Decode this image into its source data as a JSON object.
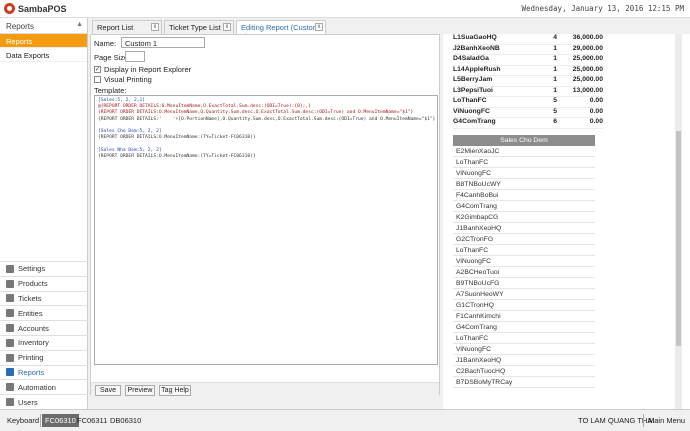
{
  "app": {
    "name": "SambaPOS",
    "datetime": "Wednesday, January 13, 2016 12:15 PM"
  },
  "sidebar": {
    "header": "Reports",
    "subitems": [
      {
        "label": "Reports"
      },
      {
        "label": "Data Exports"
      }
    ],
    "nav": [
      {
        "label": "Settings",
        "icon": "gear-icon"
      },
      {
        "label": "Products",
        "icon": "box-icon"
      },
      {
        "label": "Tickets",
        "icon": "ticket-icon"
      },
      {
        "label": "Entities",
        "icon": "entity-icon"
      },
      {
        "label": "Accounts",
        "icon": "account-icon"
      },
      {
        "label": "Inventory",
        "icon": "inventory-icon"
      },
      {
        "label": "Printing",
        "icon": "printer-icon"
      },
      {
        "label": "Reports",
        "icon": "chart-icon"
      },
      {
        "label": "Automation",
        "icon": "automation-icon"
      },
      {
        "label": "Users",
        "icon": "user-icon"
      }
    ]
  },
  "tabs": [
    {
      "label": "Report List"
    },
    {
      "label": "Ticket Type List"
    },
    {
      "label": "Editing Report (Custom 1)"
    }
  ],
  "editor": {
    "name_label": "Name:",
    "name_value": "Custom 1",
    "page_size_label": "Page Size:",
    "page_size_value": "",
    "display_explorer_label": "Display in Report Explorer",
    "display_explorer_checked": "✓",
    "visual_printing_label": "Visual Printing",
    "template_label": "Template:",
    "template_lines": [
      "[Sales:5, 2, 2,1]",
      "@{REPORT ORDER DETAILS:O.MenuItemName,O.ExactTotal.Sum.desc:(ODI=True):{0};,}",
      "{REPORT ORDER DETAILS:O.MenuItemName,O.Quantity.Sum.desc,O.ExactTotal.Sum.desc:(ODI=True) and O.MenuItemName=\"$1\"}",
      "{REPORT ORDER DETAILS:'    '+[O.PortionName],O.Quantity.Sum.desc,O.ExactTotal.Sum.desc:(ODI=True) and O.MenuItemName=\"$1\"}",
      "",
      "[Sales Cho Dem:5, 2, 2]",
      "{REPORT ORDER DETAILS:O.MenuItemName:(TY=Ticket-FC06310)}",
      "",
      "[Sales Nha Dem:5, 2, 2]",
      "{REPORT ORDER DETAILS:O.MenuItemName:(TY=Ticket-FC06310)}"
    ],
    "buttons": {
      "save": "Save",
      "preview": "Preview",
      "tag_help": "Tag Help"
    }
  },
  "report": {
    "rows": [
      {
        "name": "L1SuaGaoHQ",
        "qty": "4",
        "amount": "36,000.00"
      },
      {
        "name": "J2BanhXeoNB",
        "qty": "1",
        "amount": "29,000.00"
      },
      {
        "name": "D4SaladGa",
        "qty": "1",
        "amount": "25,000.00"
      },
      {
        "name": "L14AppleRush",
        "qty": "1",
        "amount": "25,000.00"
      },
      {
        "name": "L5BerryJam",
        "qty": "1",
        "amount": "25,000.00"
      },
      {
        "name": "L3PepsiTuoi",
        "qty": "1",
        "amount": "13,000.00"
      },
      {
        "name": "LoThanFC",
        "qty": "5",
        "amount": "0.00"
      },
      {
        "name": "ViNuongFC",
        "qty": "5",
        "amount": "0.00"
      },
      {
        "name": "G4ComTrang",
        "qty": "6",
        "amount": "0.00"
      }
    ],
    "section_title": "Sales Cho Dem",
    "section_items": [
      "E2MienXaoJC",
      "LoThanFC",
      "ViNuongFC",
      "B8TNBoUcWY",
      "F4CanhBoBui",
      "G4ComTrang",
      "K2GimbapCG",
      "J1BanhXeoHQ",
      "G2CTronFG",
      "LoThanFC",
      "ViNuongFC",
      "A2BCHeoTuoi",
      "B9TNBoUcFG",
      "A7SuonHeoWY",
      "G1CTronHQ",
      "F1CanhKimchi",
      "G4ComTrang",
      "LoThanFC",
      "ViNuongFC",
      "J1BanhXeoHQ",
      "C2BachTuocHQ",
      "B7DSBoMyTRCay"
    ]
  },
  "statusbar": {
    "keyboard": "Keyboard",
    "terminals": [
      "FC06310",
      "FC06311",
      "DB06310"
    ],
    "user": "TO LAM QUANG THAI",
    "workspace": "Main Menu"
  }
}
